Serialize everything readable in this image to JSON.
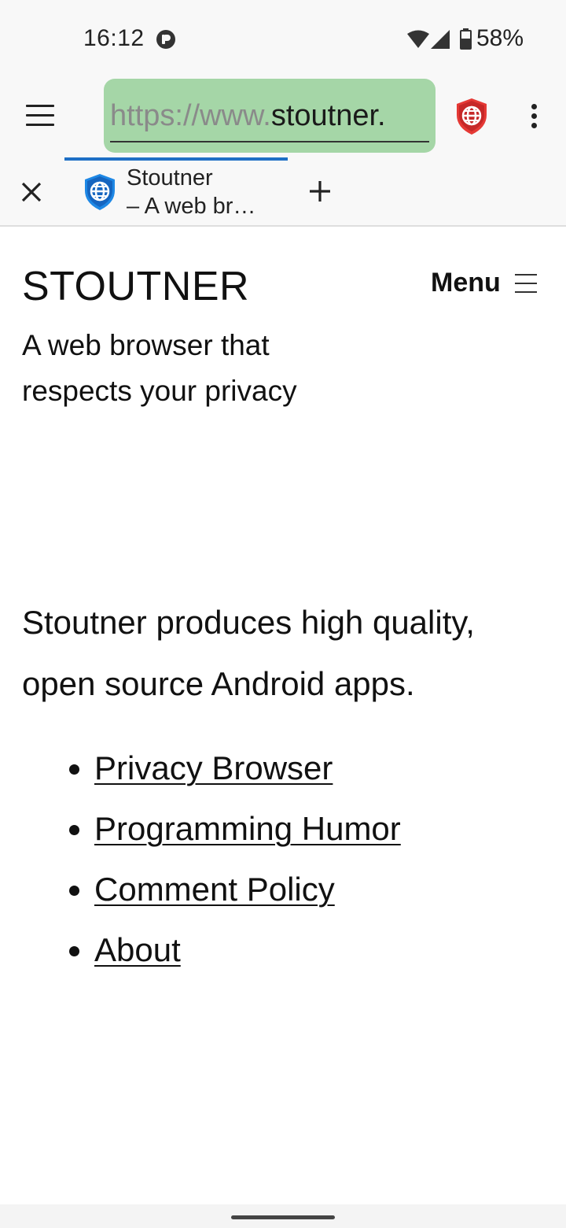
{
  "status_bar": {
    "time": "16:12",
    "battery_percent": "58%",
    "icons": [
      "notification-icon",
      "wifi-icon",
      "cell-signal-icon",
      "battery-icon"
    ]
  },
  "toolbar": {
    "url_scheme": "https://www.",
    "url_host": "stoutner.",
    "url_bar_color": "#a5d6a7",
    "icons": [
      "hamburger-menu-icon",
      "red-shield-globe-icon",
      "overflow-menu-icon"
    ]
  },
  "tabs": {
    "active_tab": {
      "title_line1": "Stoutner",
      "title_line2": "– A web br…",
      "indicator_color": "#1e6fc6"
    },
    "icons": [
      "close-icon",
      "blue-shield-globe-icon",
      "plus-icon"
    ]
  },
  "page": {
    "site_title": "STOUTNER",
    "menu_label": "Menu",
    "tagline": "A web browser that respects your privacy",
    "intro": "Stoutner produces high quality, open source Android apps.",
    "links": [
      {
        "label": "Privacy Browser"
      },
      {
        "label": "Programming Humor"
      },
      {
        "label": "Comment Policy"
      },
      {
        "label": "About"
      }
    ]
  }
}
